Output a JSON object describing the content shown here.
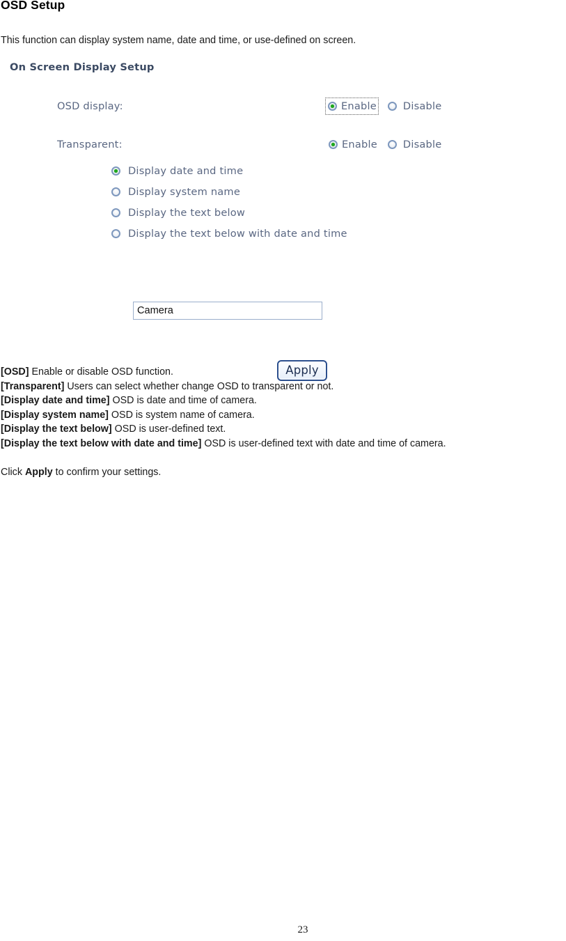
{
  "document": {
    "title": "OSD Setup",
    "intro": "This function can display system name, date and time, or use-defined on screen.",
    "page_number": "23"
  },
  "panel": {
    "heading": "On Screen Display Setup",
    "osd_display": {
      "label": "OSD display:",
      "selected": "Enable",
      "focused_option": "Enable",
      "options": [
        {
          "label": "Enable",
          "checked": true
        },
        {
          "label": "Disable",
          "checked": false
        }
      ]
    },
    "transparent": {
      "label": "Transparent:",
      "selected": "Enable",
      "options": [
        {
          "label": "Enable",
          "checked": true
        },
        {
          "label": "Disable",
          "checked": false
        }
      ]
    },
    "display_mode": {
      "selected": "Display date and time",
      "options": [
        {
          "label": "Display date and time",
          "checked": true
        },
        {
          "label": "Display system name",
          "checked": false
        },
        {
          "label": "Display the text below",
          "checked": false
        },
        {
          "label": "Display the text below with date and time",
          "checked": false
        }
      ]
    },
    "osd_text_field": {
      "value": "Camera",
      "placeholder": ""
    },
    "apply_button": {
      "label": "Apply"
    },
    "colors": {
      "heading_text": "#3b4a63",
      "label_text": "#5a6782",
      "radio_ring": "#7d97bd",
      "radio_dot_green": "#1ea81e",
      "input_border": "#9aaecb",
      "button_border": "#2b4f8e",
      "button_text": "#1d2f52"
    }
  },
  "descriptions": [
    {
      "term": "[OSD]",
      "text": " Enable or disable OSD function."
    },
    {
      "term": "[Transparent]",
      "text": " Users can select whether change OSD to transparent or not."
    },
    {
      "term": "[Display date and time]",
      "text": " OSD is date and time of camera."
    },
    {
      "term": "[Display system name]",
      "text": " OSD is system name of camera."
    },
    {
      "term": "[Display the text below]",
      "text": " OSD is user-defined text."
    },
    {
      "term": "[Display the text below with date and time]",
      "text": " OSD is user-defined text with date and time of camera."
    }
  ],
  "closing": {
    "prefix": "Click ",
    "emphasis": "Apply",
    "suffix": " to confirm your settings."
  }
}
